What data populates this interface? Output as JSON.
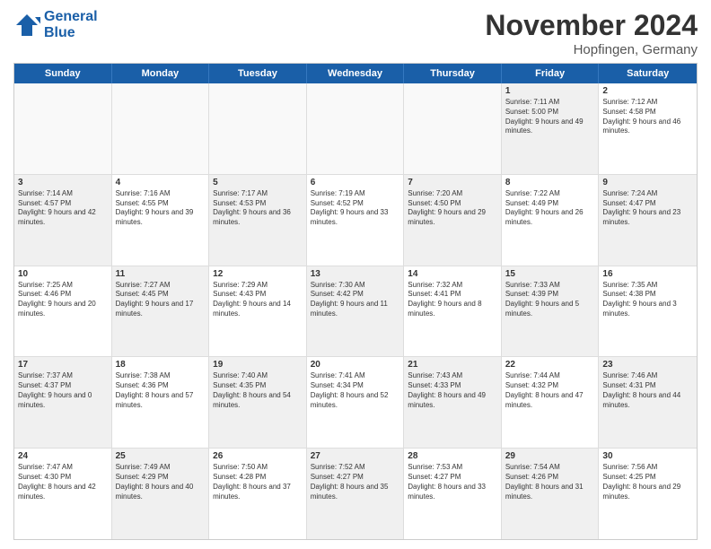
{
  "header": {
    "logo_line1": "General",
    "logo_line2": "Blue",
    "month_title": "November 2024",
    "location": "Hopfingen, Germany"
  },
  "weekdays": [
    "Sunday",
    "Monday",
    "Tuesday",
    "Wednesday",
    "Thursday",
    "Friday",
    "Saturday"
  ],
  "rows": [
    [
      {
        "day": "",
        "text": "",
        "empty": true
      },
      {
        "day": "",
        "text": "",
        "empty": true
      },
      {
        "day": "",
        "text": "",
        "empty": true
      },
      {
        "day": "",
        "text": "",
        "empty": true
      },
      {
        "day": "",
        "text": "",
        "empty": true
      },
      {
        "day": "1",
        "text": "Sunrise: 7:11 AM\nSunset: 5:00 PM\nDaylight: 9 hours and 49 minutes.",
        "empty": false,
        "shaded": true
      },
      {
        "day": "2",
        "text": "Sunrise: 7:12 AM\nSunset: 4:58 PM\nDaylight: 9 hours and 46 minutes.",
        "empty": false,
        "shaded": false
      }
    ],
    [
      {
        "day": "3",
        "text": "Sunrise: 7:14 AM\nSunset: 4:57 PM\nDaylight: 9 hours and 42 minutes.",
        "empty": false,
        "shaded": true
      },
      {
        "day": "4",
        "text": "Sunrise: 7:16 AM\nSunset: 4:55 PM\nDaylight: 9 hours and 39 minutes.",
        "empty": false,
        "shaded": false
      },
      {
        "day": "5",
        "text": "Sunrise: 7:17 AM\nSunset: 4:53 PM\nDaylight: 9 hours and 36 minutes.",
        "empty": false,
        "shaded": true
      },
      {
        "day": "6",
        "text": "Sunrise: 7:19 AM\nSunset: 4:52 PM\nDaylight: 9 hours and 33 minutes.",
        "empty": false,
        "shaded": false
      },
      {
        "day": "7",
        "text": "Sunrise: 7:20 AM\nSunset: 4:50 PM\nDaylight: 9 hours and 29 minutes.",
        "empty": false,
        "shaded": true
      },
      {
        "day": "8",
        "text": "Sunrise: 7:22 AM\nSunset: 4:49 PM\nDaylight: 9 hours and 26 minutes.",
        "empty": false,
        "shaded": false
      },
      {
        "day": "9",
        "text": "Sunrise: 7:24 AM\nSunset: 4:47 PM\nDaylight: 9 hours and 23 minutes.",
        "empty": false,
        "shaded": true
      }
    ],
    [
      {
        "day": "10",
        "text": "Sunrise: 7:25 AM\nSunset: 4:46 PM\nDaylight: 9 hours and 20 minutes.",
        "empty": false,
        "shaded": false
      },
      {
        "day": "11",
        "text": "Sunrise: 7:27 AM\nSunset: 4:45 PM\nDaylight: 9 hours and 17 minutes.",
        "empty": false,
        "shaded": true
      },
      {
        "day": "12",
        "text": "Sunrise: 7:29 AM\nSunset: 4:43 PM\nDaylight: 9 hours and 14 minutes.",
        "empty": false,
        "shaded": false
      },
      {
        "day": "13",
        "text": "Sunrise: 7:30 AM\nSunset: 4:42 PM\nDaylight: 9 hours and 11 minutes.",
        "empty": false,
        "shaded": true
      },
      {
        "day": "14",
        "text": "Sunrise: 7:32 AM\nSunset: 4:41 PM\nDaylight: 9 hours and 8 minutes.",
        "empty": false,
        "shaded": false
      },
      {
        "day": "15",
        "text": "Sunrise: 7:33 AM\nSunset: 4:39 PM\nDaylight: 9 hours and 5 minutes.",
        "empty": false,
        "shaded": true
      },
      {
        "day": "16",
        "text": "Sunrise: 7:35 AM\nSunset: 4:38 PM\nDaylight: 9 hours and 3 minutes.",
        "empty": false,
        "shaded": false
      }
    ],
    [
      {
        "day": "17",
        "text": "Sunrise: 7:37 AM\nSunset: 4:37 PM\nDaylight: 9 hours and 0 minutes.",
        "empty": false,
        "shaded": true
      },
      {
        "day": "18",
        "text": "Sunrise: 7:38 AM\nSunset: 4:36 PM\nDaylight: 8 hours and 57 minutes.",
        "empty": false,
        "shaded": false
      },
      {
        "day": "19",
        "text": "Sunrise: 7:40 AM\nSunset: 4:35 PM\nDaylight: 8 hours and 54 minutes.",
        "empty": false,
        "shaded": true
      },
      {
        "day": "20",
        "text": "Sunrise: 7:41 AM\nSunset: 4:34 PM\nDaylight: 8 hours and 52 minutes.",
        "empty": false,
        "shaded": false
      },
      {
        "day": "21",
        "text": "Sunrise: 7:43 AM\nSunset: 4:33 PM\nDaylight: 8 hours and 49 minutes.",
        "empty": false,
        "shaded": true
      },
      {
        "day": "22",
        "text": "Sunrise: 7:44 AM\nSunset: 4:32 PM\nDaylight: 8 hours and 47 minutes.",
        "empty": false,
        "shaded": false
      },
      {
        "day": "23",
        "text": "Sunrise: 7:46 AM\nSunset: 4:31 PM\nDaylight: 8 hours and 44 minutes.",
        "empty": false,
        "shaded": true
      }
    ],
    [
      {
        "day": "24",
        "text": "Sunrise: 7:47 AM\nSunset: 4:30 PM\nDaylight: 8 hours and 42 minutes.",
        "empty": false,
        "shaded": false
      },
      {
        "day": "25",
        "text": "Sunrise: 7:49 AM\nSunset: 4:29 PM\nDaylight: 8 hours and 40 minutes.",
        "empty": false,
        "shaded": true
      },
      {
        "day": "26",
        "text": "Sunrise: 7:50 AM\nSunset: 4:28 PM\nDaylight: 8 hours and 37 minutes.",
        "empty": false,
        "shaded": false
      },
      {
        "day": "27",
        "text": "Sunrise: 7:52 AM\nSunset: 4:27 PM\nDaylight: 8 hours and 35 minutes.",
        "empty": false,
        "shaded": true
      },
      {
        "day": "28",
        "text": "Sunrise: 7:53 AM\nSunset: 4:27 PM\nDaylight: 8 hours and 33 minutes.",
        "empty": false,
        "shaded": false
      },
      {
        "day": "29",
        "text": "Sunrise: 7:54 AM\nSunset: 4:26 PM\nDaylight: 8 hours and 31 minutes.",
        "empty": false,
        "shaded": true
      },
      {
        "day": "30",
        "text": "Sunrise: 7:56 AM\nSunset: 4:25 PM\nDaylight: 8 hours and 29 minutes.",
        "empty": false,
        "shaded": false
      }
    ]
  ]
}
